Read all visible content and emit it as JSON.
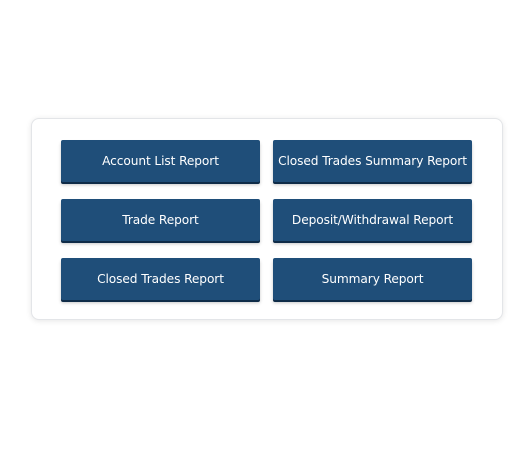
{
  "reports": {
    "account_list_label": "Account List Report",
    "closed_trades_summary_label": "Closed Trades Summary Report",
    "trade_label": "Trade Report",
    "deposit_withdrawal_label": "Deposit/Withdrawal Report",
    "closed_trades_label": "Closed Trades Report",
    "summary_label": "Summary Report"
  },
  "colors": {
    "button_background": "#1f4e79",
    "button_text": "#ffffff",
    "card_background": "#ffffff"
  }
}
